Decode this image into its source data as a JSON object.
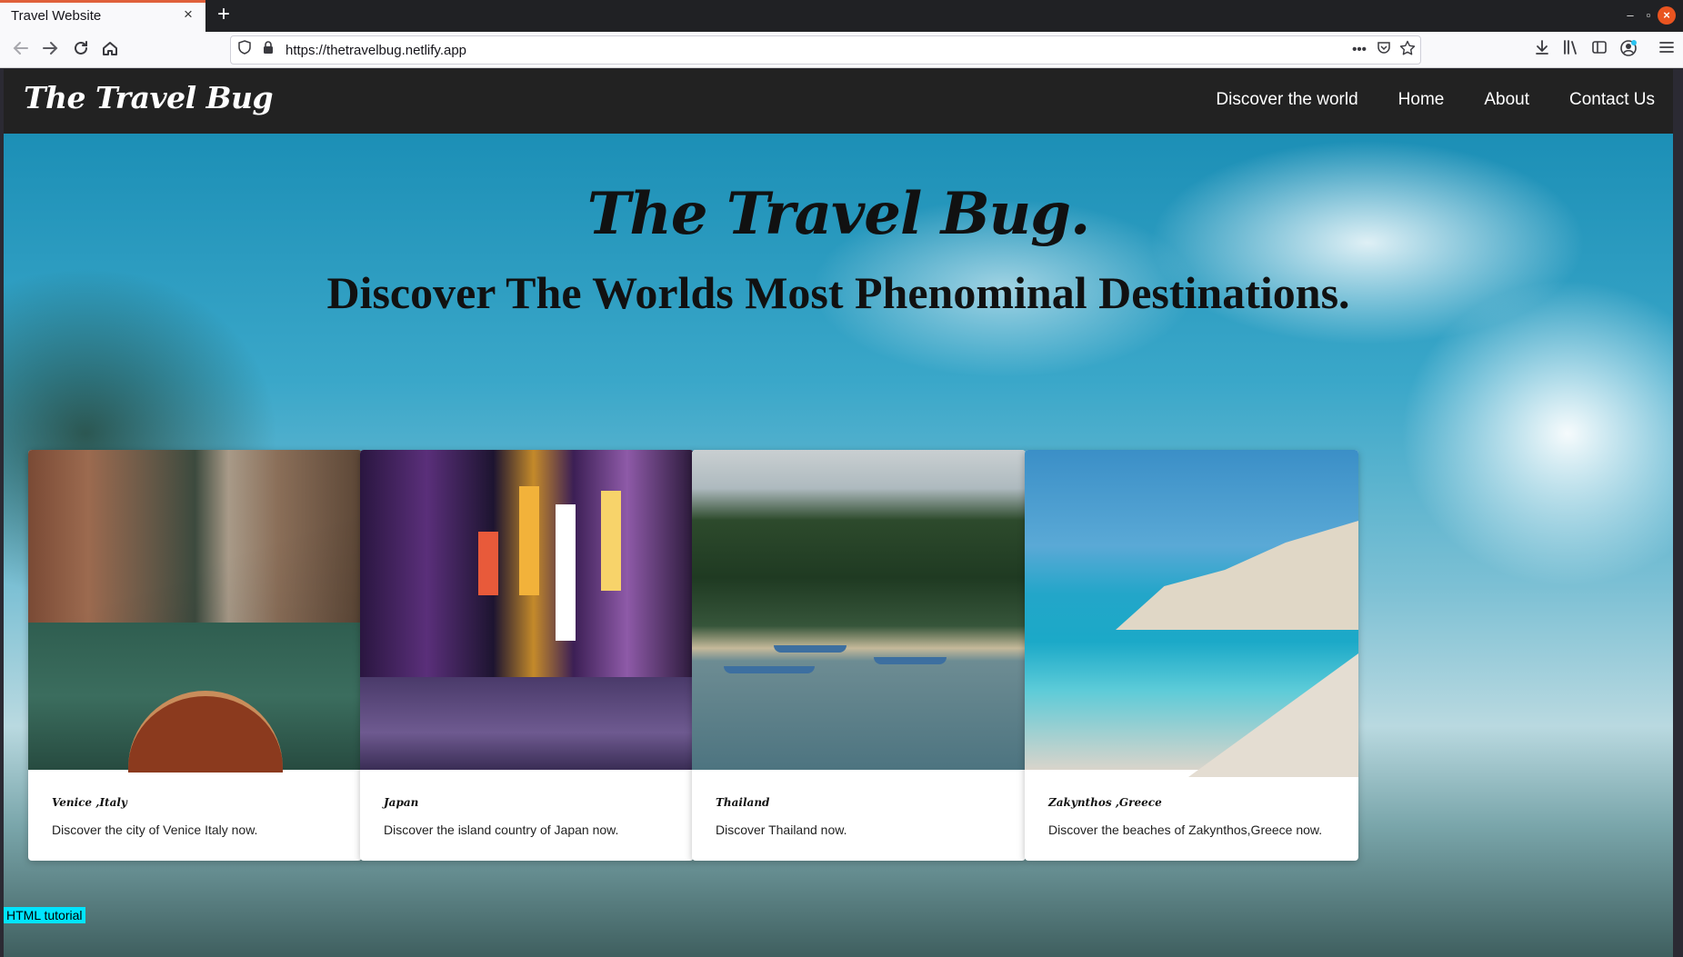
{
  "browser": {
    "tab_title": "Travel Website",
    "tab_close": "×",
    "new_tab": "+",
    "url": "https://thetravelbug.netlify.app",
    "window_controls": {
      "minimize": "–",
      "restore": "▫",
      "close": "×"
    }
  },
  "site": {
    "brand": "The Travel Bug",
    "nav": [
      "Discover the world",
      "Home",
      "About",
      "Contact Us"
    ],
    "hero_title": "The Travel Bug.",
    "hero_subtitle": "Discover The Worlds Most Phenominal Destinations.",
    "cards": [
      {
        "title": "Venice ,Italy",
        "desc": "Discover the city of Venice Italy now."
      },
      {
        "title": "Japan",
        "desc": "Discover the island country of Japan now."
      },
      {
        "title": "Thailand",
        "desc": "Discover Thailand now."
      },
      {
        "title": "Zakynthos ,Greece",
        "desc": "Discover the beaches of Zakynthos,Greece now."
      }
    ],
    "tag": "HTML tutorial"
  },
  "icons": {
    "back": "back-arrow-icon",
    "forward": "forward-arrow-icon",
    "reload": "reload-icon",
    "home": "home-icon",
    "shield": "tracking-shield-icon",
    "lock": "lock-icon",
    "more": "page-actions-icon",
    "pocket": "pocket-icon",
    "star": "bookmark-star-icon",
    "download": "download-icon",
    "library": "library-icon",
    "sidebar": "sidebar-icon",
    "account": "account-icon",
    "menu": "hamburger-menu-icon"
  }
}
